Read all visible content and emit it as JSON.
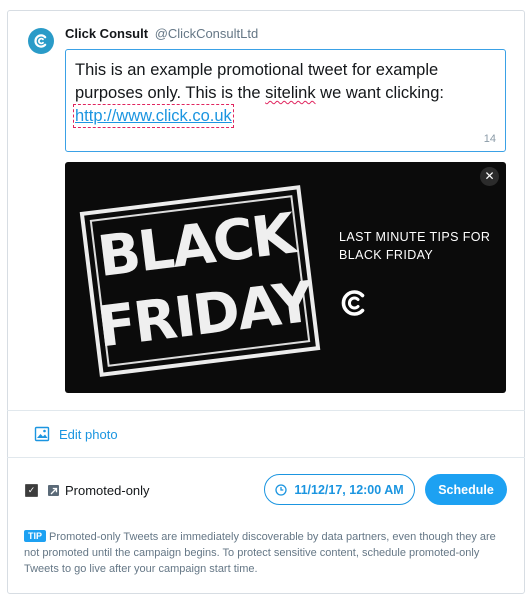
{
  "author": {
    "name": "Click Consult",
    "handle": "@ClickConsultLtd"
  },
  "compose": {
    "text_before_sitelink": "This is an example promotional tweet for example purposes only. This is the ",
    "sitelink_word": "sitelink",
    "text_after_sitelink": " we want clicking:",
    "url": "http://www.click.co.uk",
    "char_count": "14"
  },
  "media": {
    "stamp_line1": "BLACK",
    "stamp_line2": "FRIDAY",
    "headline": "LAST MINUTE TIPS FOR BLACK FRIDAY",
    "close_icon": "close-icon",
    "logo_icon": "click-consult-logo-icon"
  },
  "actions": {
    "edit_photo_label": "Edit photo",
    "promoted_only_label": "Promoted-only",
    "promoted_only_checked": true,
    "date_label": "11/12/17, 12:00 AM",
    "schedule_label": "Schedule"
  },
  "tip": {
    "badge": "TIP",
    "text": "Promoted-only Tweets are immediately discoverable by data partners, even though they are not promoted until the campaign begins. To protect sensitive content, schedule promoted-only Tweets to go live after your campaign start time."
  },
  "colors": {
    "accent": "#1da1f2",
    "link": "#1b95e0",
    "avatar": "#2a9bc8",
    "spellcheck": "#e0245e",
    "media_bg": "#0b0b0b"
  }
}
